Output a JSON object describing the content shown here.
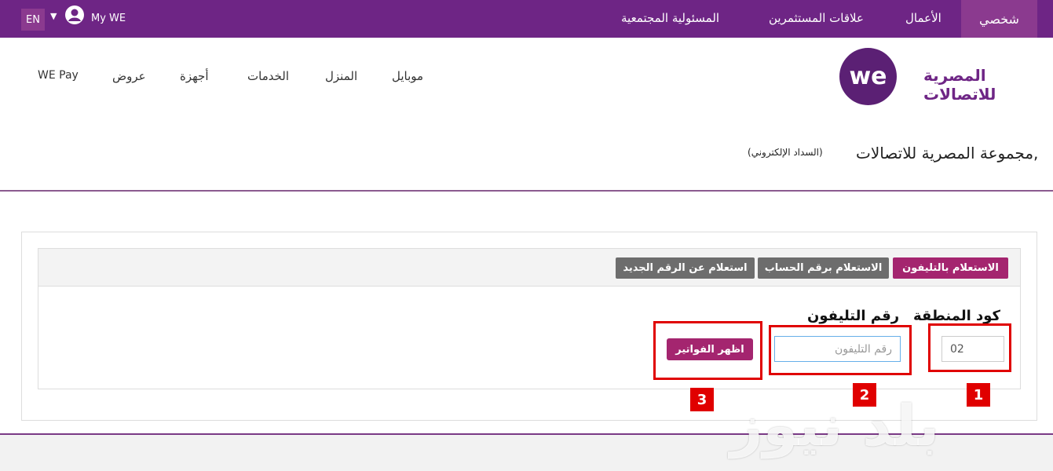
{
  "topbar": {
    "lang": "EN",
    "my_we": "My WE",
    "nav": [
      "المسئولية المجتمعية",
      "علاقات المستثمرين",
      "الأعمال"
    ],
    "personal": "شخصي"
  },
  "header": {
    "brand_text": "المصرية للاتصالات",
    "logo_text": "we",
    "nav": [
      "موبايل",
      "المنزل",
      "الخدمات",
      "أجهزة",
      "عروض",
      "WE Pay"
    ]
  },
  "page": {
    "title": "مجموعة المصرية للاتصالات,",
    "subtitle": "(السداد الإلكتروني)"
  },
  "tabs": [
    {
      "label": "الاستعلام بالتليفون",
      "active": true
    },
    {
      "label": "الاستعلام برقم الحساب",
      "active": false
    },
    {
      "label": "استعلام عن الرقم الجديد",
      "active": false
    }
  ],
  "form": {
    "area_label": "كود المنطقة",
    "phone_label": "رقم التليفون",
    "area_value": "02",
    "phone_placeholder": "رقم التليفون",
    "submit_label": "اظهر الفواتير"
  },
  "annotations": [
    "1",
    "2",
    "3"
  ],
  "watermark": "بلد نيوز",
  "colors": {
    "brand_purple": "#6e2585",
    "accent_magenta": "#a4256f",
    "annotation_red": "#e00000"
  }
}
